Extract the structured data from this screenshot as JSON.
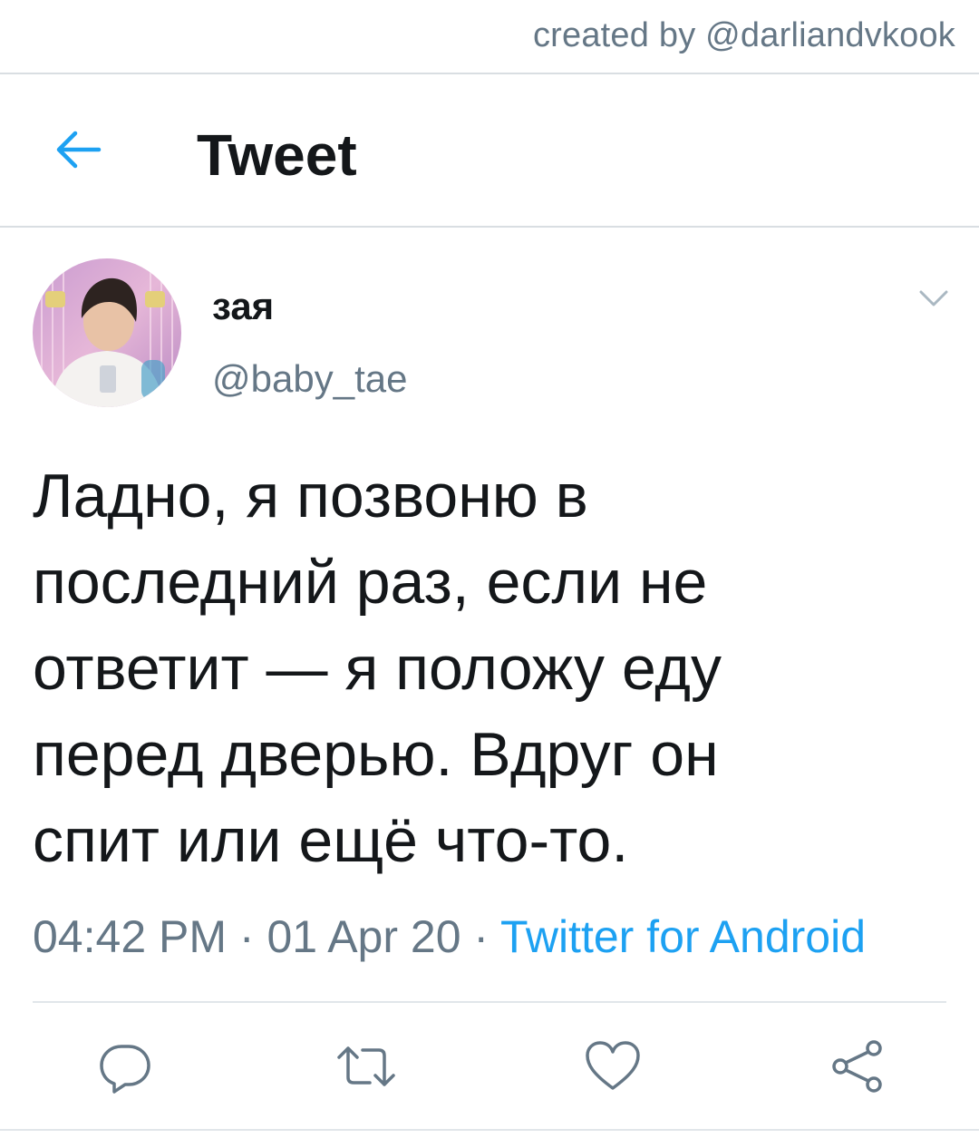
{
  "watermark": "created by @darliandvkook",
  "header": {
    "title": "Tweet",
    "back_icon": "arrow-left-icon"
  },
  "tweet": {
    "author": {
      "display_name": "зая",
      "handle": "@baby_tae"
    },
    "text_lines": [
      "Ладно, я позвоню в",
      "последний раз, если не",
      "ответит — я положу еду",
      "перед дверью. Вдруг он",
      "спит или ещё что-то."
    ],
    "time": "04:42 PM",
    "date": "01 Apr 20",
    "separator": " · ",
    "source": "Twitter for Android"
  },
  "actions": [
    {
      "icon": "reply-icon"
    },
    {
      "icon": "retweet-icon"
    },
    {
      "icon": "like-icon"
    },
    {
      "icon": "share-icon"
    }
  ],
  "colors": {
    "accent": "#1da1f2",
    "text": "#14171a",
    "secondary": "#657786",
    "divider": "#d9dee2"
  }
}
